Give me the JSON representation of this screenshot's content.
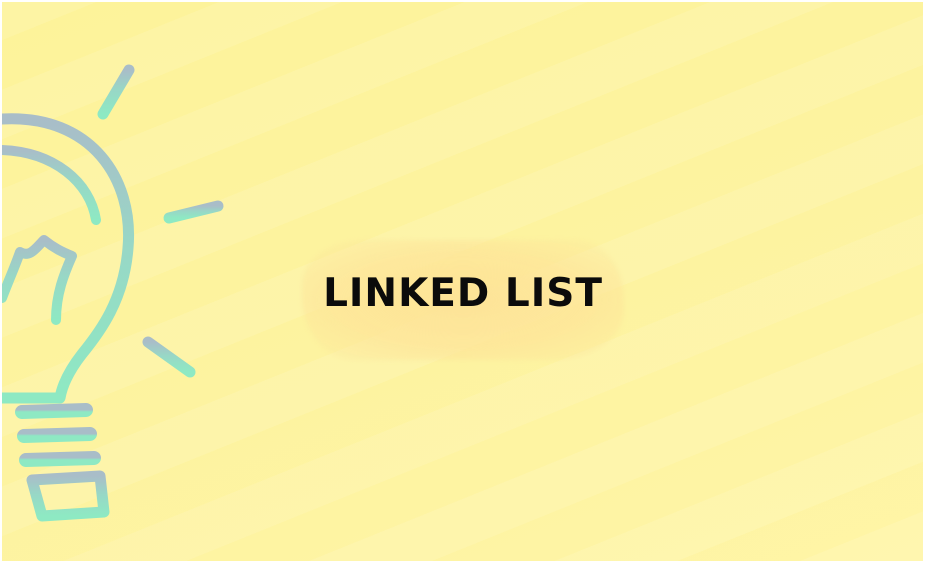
{
  "title": "LINKED LIST",
  "colors": {
    "background": "#fdf39e",
    "highlight": "#fde296",
    "bulb_top": "#a8c3c5",
    "bulb_bottom": "#8ee6c2",
    "text": "#0b0b0b"
  },
  "icons": [
    "lightbulb-icon"
  ]
}
